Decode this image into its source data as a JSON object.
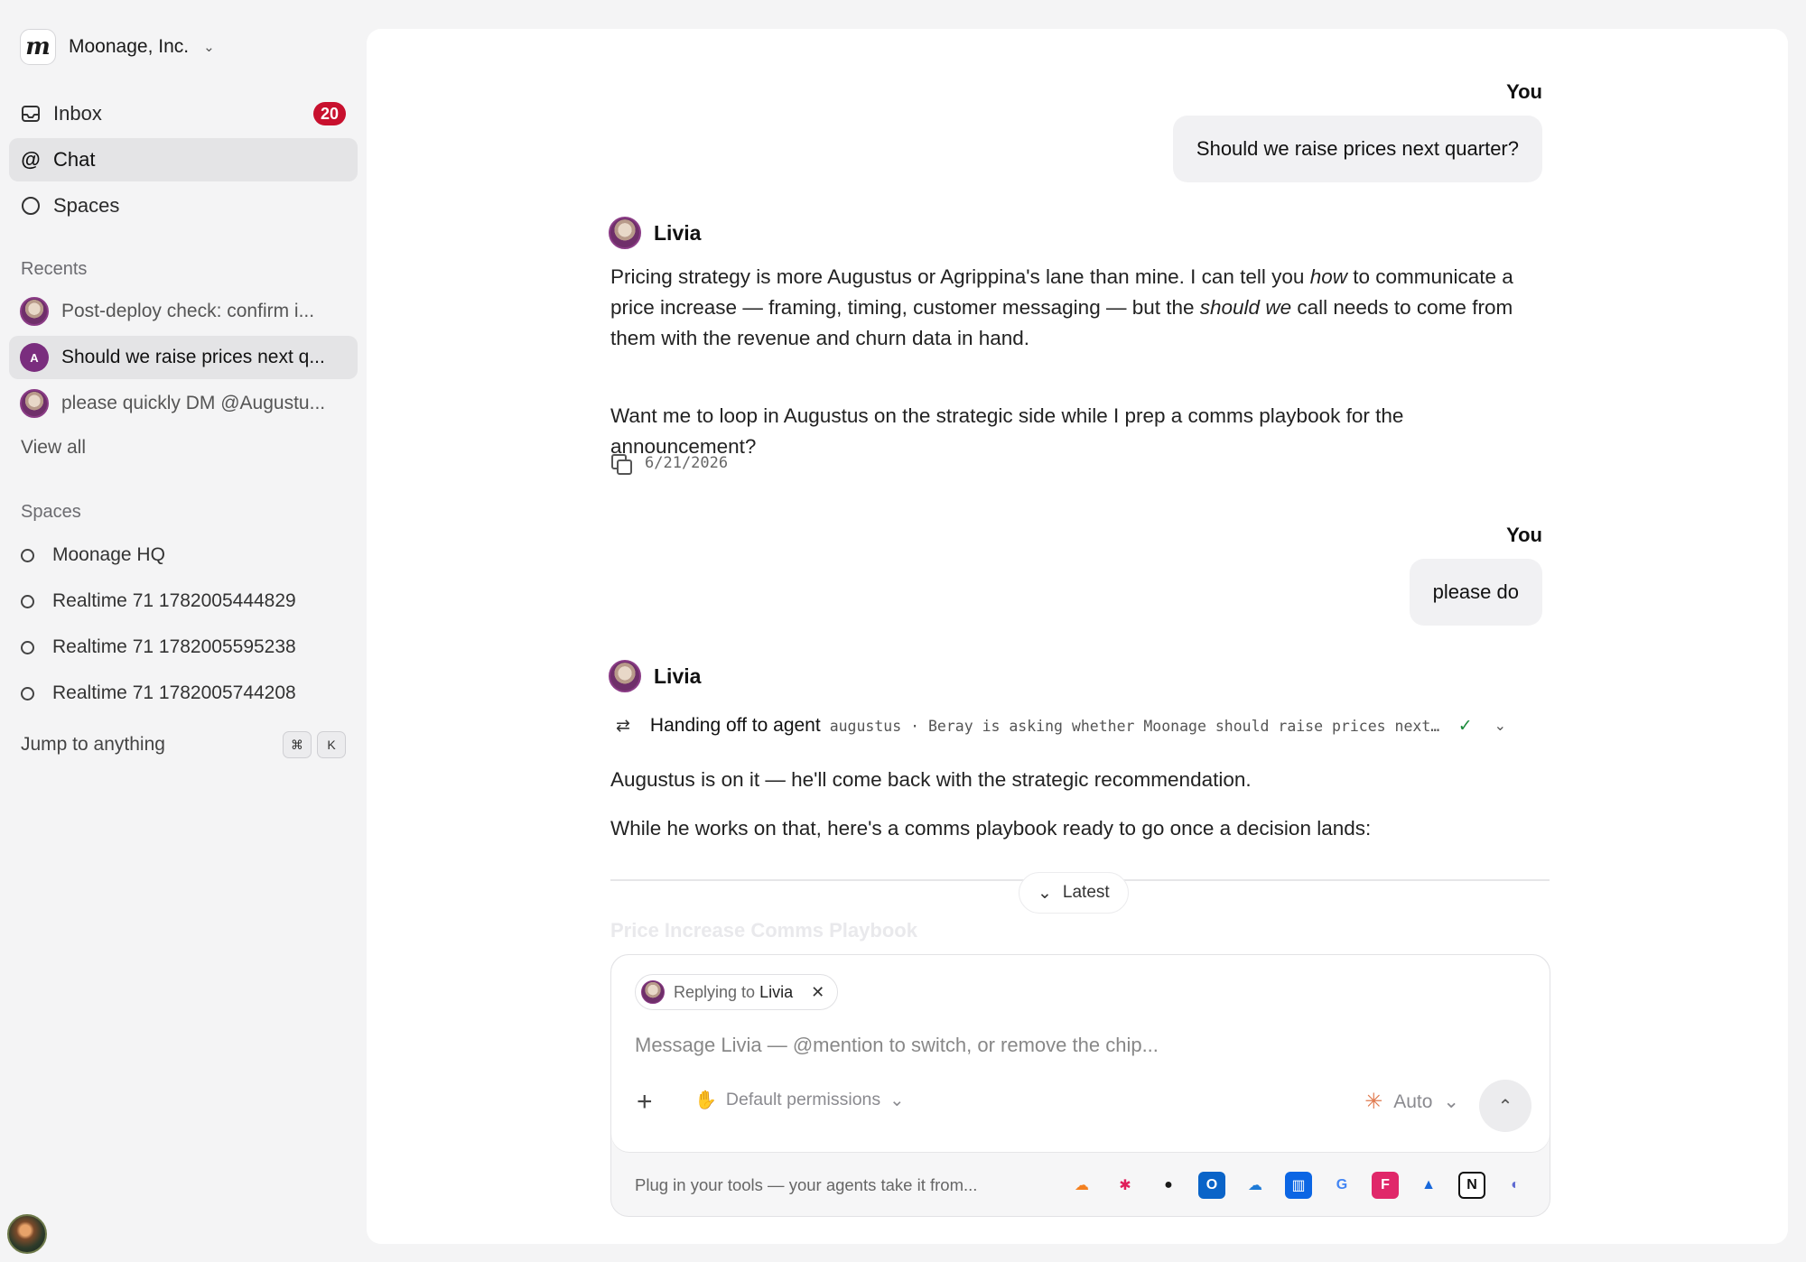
{
  "org": {
    "name": "Moonage, Inc.",
    "logo_letter": "m"
  },
  "nav": {
    "inbox": {
      "label": "Inbox",
      "badge": "20"
    },
    "chat": {
      "label": "Chat"
    },
    "spaces": {
      "label": "Spaces"
    }
  },
  "recents": {
    "label": "Recents",
    "items": [
      "Post-deploy check: confirm i...",
      "Should we raise prices next q...",
      "please quickly DM @Augustu..."
    ],
    "active_avatar_letter": "A",
    "view_all": "View all"
  },
  "spaces": {
    "label": "Spaces",
    "items": [
      "Moonage HQ",
      "Realtime 71 1782005444829",
      "Realtime 71 1782005595238",
      "Realtime 71 1782005744208"
    ]
  },
  "jump": {
    "label": "Jump to anything",
    "keys": [
      "⌘",
      "K"
    ]
  },
  "conversation": {
    "you_label": "You",
    "msg1": "Should we raise prices next quarter?",
    "agent_name": "Livia",
    "reply1_p1_a": "Pricing strategy is more Augustus or Agrippina's lane than mine. I can tell you ",
    "reply1_p1_em1": "how",
    "reply1_p1_b": " to communicate a price increase — framing, timing, customer messaging — but the ",
    "reply1_p1_em2": "should we",
    "reply1_p1_c": " call needs to come from them with the revenue and churn data in hand.",
    "reply1_p2": "Want me to loop in Augustus on the strategic side while I prep a comms playbook for the announcement?",
    "reply1_date": "6/21/2026",
    "msg2": "please do",
    "handoff_title": "Handing off to agent",
    "handoff_detail": "augustus · Beray is asking whether Moonage should raise prices next quarter",
    "reply2_p1": "Augustus is on it — he'll come back with the strategic recommendation.",
    "reply2_p2": "While he works on that, here's a comms playbook ready to go once a decision lands:",
    "ghost_heading": "Price Increase Comms Playbook",
    "latest_label": "Latest"
  },
  "composer": {
    "chip_prefix": "Replying to",
    "chip_name": "Livia",
    "placeholder": "Message Livia — @mention to switch, or remove the chip...",
    "permissions": "Default permissions",
    "model": "Auto",
    "tools_text": "Plug in your tools — your agents take it from..."
  },
  "tools": [
    {
      "name": "cloudflare-icon",
      "glyph": "☁",
      "color": "#f38020",
      "bg": "transparent"
    },
    {
      "name": "slack-icon",
      "glyph": "✱",
      "color": "#e01e5a",
      "bg": "transparent"
    },
    {
      "name": "github-icon",
      "glyph": "●",
      "color": "#1a1a1a",
      "bg": "transparent"
    },
    {
      "name": "outlook-icon",
      "glyph": "O",
      "color": "#ffffff",
      "bg": "#0a64c8"
    },
    {
      "name": "onedrive-icon",
      "glyph": "☁",
      "color": "#1e7ad6",
      "bg": "transparent"
    },
    {
      "name": "trello-icon",
      "glyph": "▥",
      "color": "#ffffff",
      "bg": "#0c66e4"
    },
    {
      "name": "google-icon",
      "glyph": "G",
      "color": "#4285f4",
      "bg": "transparent"
    },
    {
      "name": "figma-icon",
      "glyph": "F",
      "color": "#ffffff",
      "bg": "#e0286a"
    },
    {
      "name": "atlassian-icon",
      "glyph": "▲",
      "color": "#1868db",
      "bg": "transparent"
    },
    {
      "name": "notion-icon",
      "glyph": "N",
      "color": "#111111",
      "bg": "#ffffff"
    },
    {
      "name": "linear-icon",
      "glyph": "◐",
      "color": "#5e6ad2",
      "bg": "transparent"
    }
  ]
}
